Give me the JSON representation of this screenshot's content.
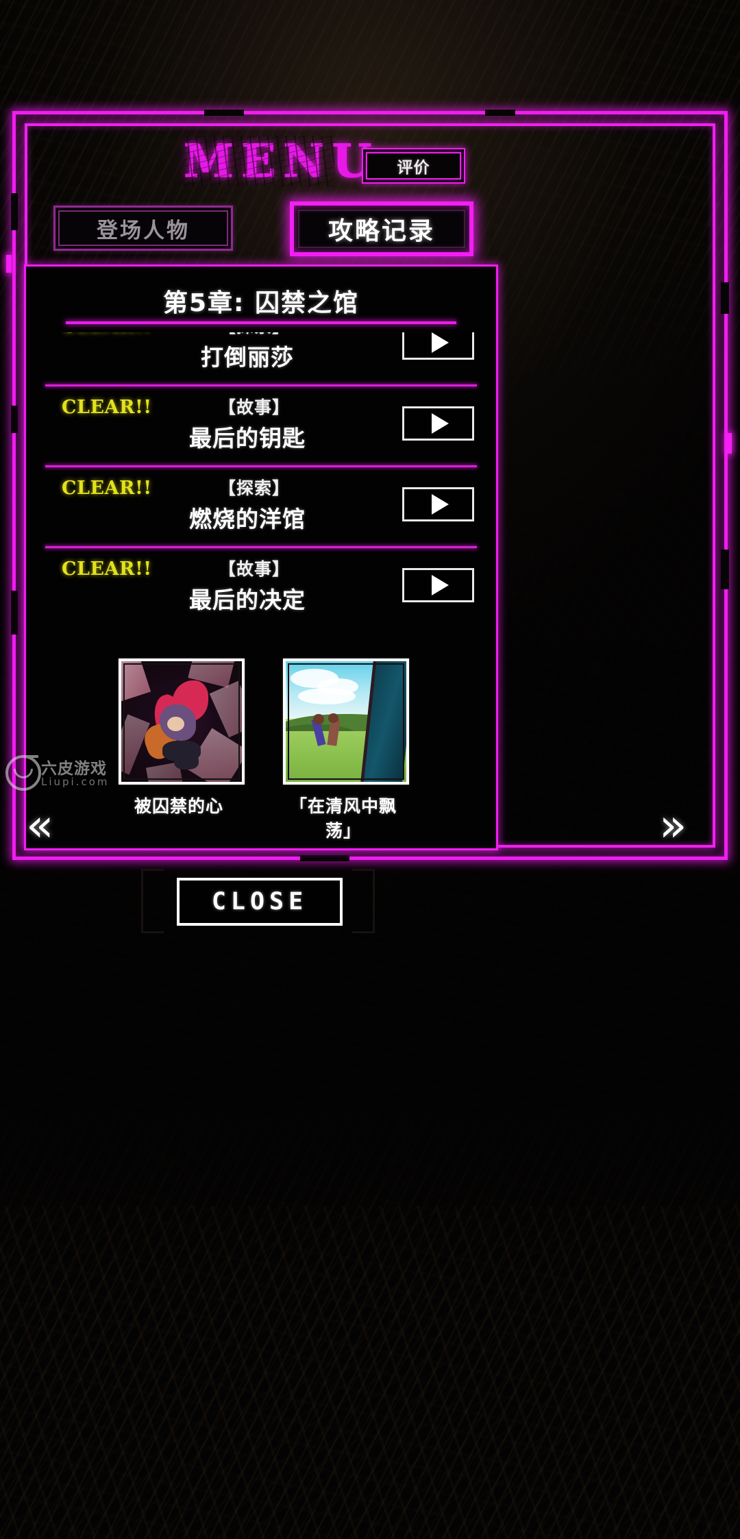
{
  "header": {
    "menu_title": "MENU",
    "rating_button": "评价"
  },
  "tabs": [
    {
      "label": "登场人物",
      "active": false
    },
    {
      "label": "攻略记录",
      "active": true
    }
  ],
  "panel": {
    "chapter_title": "第5章: 囚禁之馆",
    "rows": [
      {
        "clear": "CLEAR!!",
        "category": "【探索】",
        "title": "打倒丽莎",
        "play": "play-icon"
      },
      {
        "clear": "CLEAR!!",
        "category": "【故事】",
        "title": "最后的钥匙",
        "play": "play-icon"
      },
      {
        "clear": "CLEAR!!",
        "category": "【探索】",
        "title": "燃烧的洋馆",
        "play": "play-icon"
      },
      {
        "clear": "CLEAR!!",
        "category": "【故事】",
        "title": "最后的决定",
        "play": "play-icon"
      }
    ],
    "thumbnails": [
      {
        "caption": "被囚禁的心"
      },
      {
        "caption": "「在清风中飘荡」"
      }
    ]
  },
  "nav": {
    "prev": "«",
    "next": "»"
  },
  "watermark": {
    "name": "六皮游戏",
    "url": "Liupi.com"
  },
  "footer": {
    "close_label": "CLOSE"
  },
  "colors": {
    "neon_magenta": "#f01ef0",
    "clear_yellow": "#e2e21c",
    "text_white": "#ffffff",
    "inactive_tab": "#8f2a8f",
    "background": "#050404"
  }
}
